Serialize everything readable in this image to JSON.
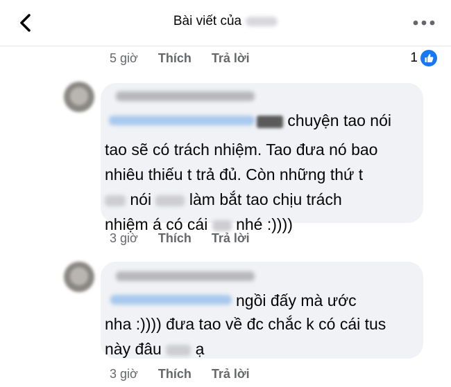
{
  "header": {
    "title": "Bài viết của",
    "back_icon": "chevron-left-icon",
    "more_icon": "more-horizontal-icon"
  },
  "top_meta": {
    "time": "5 giờ",
    "like": "Thích",
    "reply": "Trả lời",
    "reaction_count": "1"
  },
  "comments": [
    {
      "lines": [
        "chuyện tao nói",
        "tao sẽ có trách nhiệm. Tao đưa nó bao",
        "nhiêu thiếu t trả đủ. Còn những thứ t",
        "nói",
        "làm  bắt tao chịu trách",
        "nhiệm á có cái",
        "nhé :))))"
      ],
      "time": "3 giờ",
      "like": "Thích",
      "reply": "Trả lời"
    },
    {
      "lines": [
        "ngồi đấy mà ước",
        "nha :)))) đưa tao về đc chắc k có cái tus",
        "này đâu",
        "ạ"
      ],
      "time": "3 giờ",
      "like": "Thích",
      "reply": "Trả lời"
    }
  ],
  "colors": {
    "bubble": "#f0f2f5",
    "meta": "#65676b",
    "like_blue": "#1877f2"
  }
}
